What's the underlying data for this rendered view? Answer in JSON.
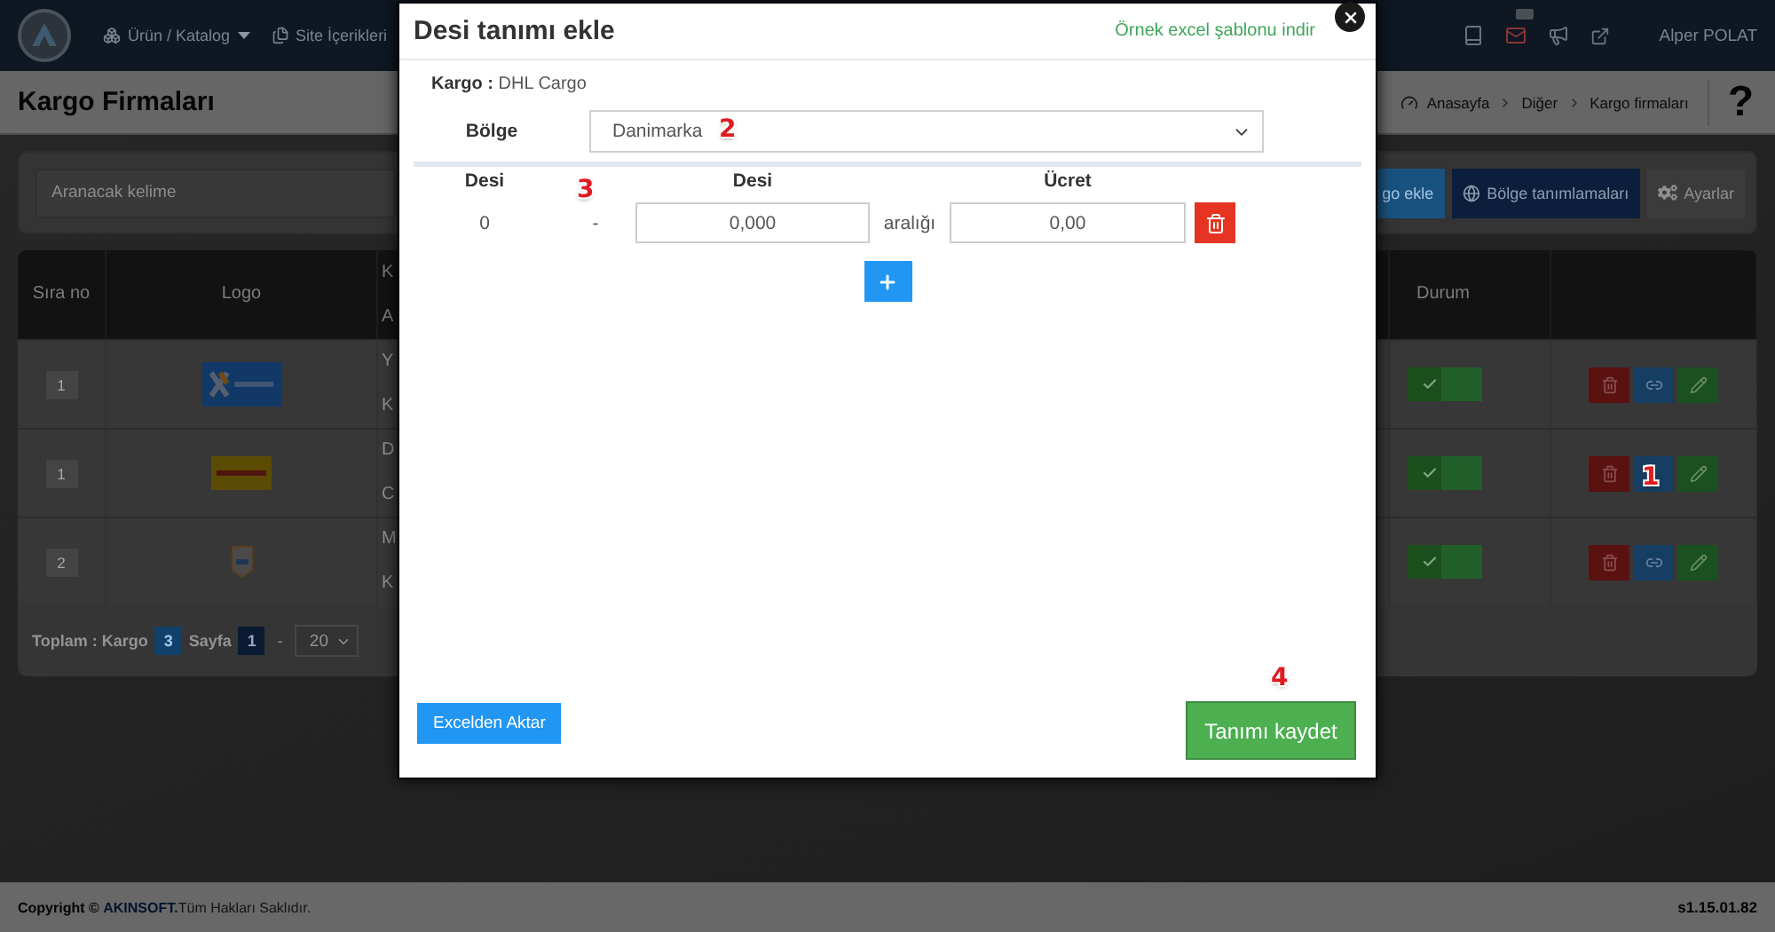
{
  "navbar": {
    "menu": [
      {
        "label": "Ürün / Katalog",
        "dropdown": true
      },
      {
        "label": "Site İçerikleri",
        "dropdown": false
      }
    ],
    "user": "Alper POLAT"
  },
  "page_header": {
    "title": "Kargo Firmaları",
    "breadcrumbs": [
      "Anasayfa",
      "Diğer",
      "Kargo firmaları"
    ],
    "help": "?"
  },
  "search": {
    "placeholder": "Aranacak kelime"
  },
  "toolbar": [
    {
      "kind": "add",
      "label": "go ekle"
    },
    {
      "kind": "regions",
      "label": "Bölge tanımlamaları"
    },
    {
      "kind": "settings",
      "label": "Ayarlar"
    }
  ],
  "table": {
    "columns": {
      "sira_no": "Sıra no",
      "logo": "Logo",
      "column_3": [
        "K",
        "A"
      ],
      "durum": "Durum"
    },
    "rows": [
      {
        "sira_no": "1",
        "kind": "banner",
        "column_3": [
          "Y",
          "K"
        ],
        "active": true
      },
      {
        "sira_no": "1",
        "kind": "stripe",
        "column_3": [
          "D",
          "C"
        ],
        "active": true,
        "marker": "1"
      },
      {
        "sira_no": "2",
        "kind": "emblem",
        "column_3": [
          "M",
          "K"
        ],
        "active": true
      }
    ],
    "footer": {
      "total_label": "Toplam : Kargo",
      "total": "3",
      "page_label": "Sayfa",
      "page": "1",
      "separator": "-",
      "page_size": "20"
    }
  },
  "footer": {
    "copyright": "Copyright ©",
    "brand": "AKINSOFT.",
    "rights": "Tüm Hakları Saklıdır.",
    "version": "s1.15.01.82"
  },
  "modal": {
    "title": "Desi tanımı ekle",
    "template_link": "Örnek excel şablonu indir",
    "kargo_label": "Kargo :",
    "kargo_value": "DHL Cargo",
    "region": {
      "label": "Bölge",
      "value": "Danimarka",
      "marker": "2"
    },
    "desi_table": {
      "columns": [
        "Desi",
        "Desi",
        "Ücret"
      ],
      "marker": "3",
      "rows": [
        {
          "from": "0",
          "separator": "-",
          "to": "0,000",
          "range_label": "aralığı",
          "price": "0,00"
        }
      ]
    },
    "import_button": "Excelden Aktar",
    "save_button": {
      "label": "Tanımı kaydet",
      "marker": "4"
    }
  }
}
